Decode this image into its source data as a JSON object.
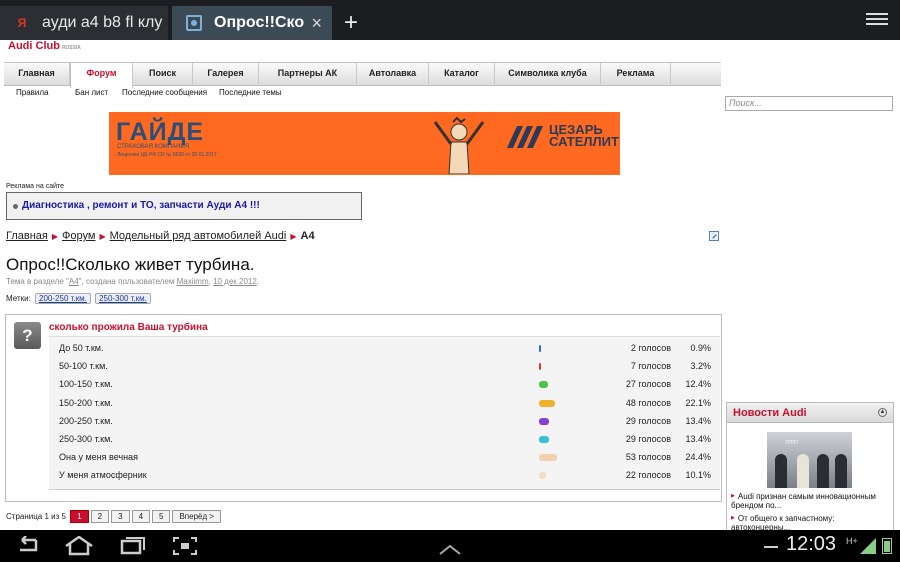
{
  "browser": {
    "tabs": [
      {
        "title": "ауди а4 b8 fl клу",
        "favicon": "yandex-icon",
        "active": false
      },
      {
        "title": "Опрос!!Ско",
        "favicon": "globe-icon",
        "active": true
      }
    ],
    "new_tab": "+",
    "close_glyph": "×"
  },
  "site": {
    "logo": "Audi Club",
    "logo_sub": "RUSSIA",
    "nav": [
      "Главная",
      "Форум",
      "Поиск",
      "Галерея",
      "Партнеры АК",
      "Автолавка",
      "Каталог",
      "Символика клуба",
      "Реклама"
    ],
    "nav_active": "Форум",
    "subnav": [
      "Правила",
      "Бан лист",
      "Последние сообщения",
      "Последние темы"
    ],
    "search_placeholder": "Поиск..."
  },
  "banner": {
    "brand": "ГАЙДЕ",
    "brand_sub": "СТРАХОВАЯ КОМПАНИЯ",
    "brand_license": "Лицензия ЦБ РФ СИ № 0630 от 29.01.2017",
    "partner_line1": "ЦЕЗАРЬ",
    "partner_line2": "САТЕЛЛИТ",
    "color": "#ff6a20"
  },
  "ad": {
    "label": "Реклама на сайте",
    "link": "Диагностика , ремонт и ТО, запчасти Ауди А4 !!!"
  },
  "breadcrumb": [
    "Главная",
    "Форум",
    "Модельный ряд автомобилей Audi",
    "A4"
  ],
  "thread": {
    "title": "Опрос!!Сколько живет турбина.",
    "meta_prefix": "Тема в разделе \"",
    "meta_section": "A4",
    "meta_middle": "\", создана пользователем ",
    "meta_user": "Maxiimm",
    "meta_sep": ", ",
    "meta_date": "10 дек 2012",
    "meta_end": ".",
    "tags_label": "Метки:",
    "tags": [
      "200-250 т.км.",
      "250-300 т.км."
    ]
  },
  "poll": {
    "icon": "?",
    "title": "сколько прожила Ваша турбина",
    "options": [
      {
        "label": "До 50 т.км.",
        "votes": "2 голосов",
        "pct": "0.9%",
        "share": 0.9,
        "color": "#2a6fd6"
      },
      {
        "label": "50-100 т.км.",
        "votes": "7 голосов",
        "pct": "3.2%",
        "share": 3.2,
        "color": "#e03a2a"
      },
      {
        "label": "100-150 т.км.",
        "votes": "27 голосов",
        "pct": "12.4%",
        "share": 12.4,
        "color": "#4cc24c"
      },
      {
        "label": "150-200 т.км.",
        "votes": "48 голосов",
        "pct": "22.1%",
        "share": 22.1,
        "color": "#f0b030"
      },
      {
        "label": "200-250 т.км.",
        "votes": "29 голосов",
        "pct": "13.4%",
        "share": 13.4,
        "color": "#8a3fd0"
      },
      {
        "label": "250-300 т.км.",
        "votes": "29 голосов",
        "pct": "13.4%",
        "share": 13.4,
        "color": "#38c0d8"
      },
      {
        "label": "Она у меня вечная",
        "votes": "53 голосов",
        "pct": "24.4%",
        "share": 24.4,
        "color": "#f3d0b0"
      },
      {
        "label": "У меня атмосферник",
        "votes": "22 голосов",
        "pct": "10.1%",
        "share": 10.1,
        "color": "#f7dcc4"
      }
    ]
  },
  "pager": {
    "label": "Страница 1 из 5",
    "pages": [
      "1",
      "2",
      "3",
      "4",
      "5"
    ],
    "current": "1",
    "next": "Вперёд >"
  },
  "news": {
    "title": "Новости Audi",
    "collapse": "▲",
    "items": [
      "Audi признан самым инновационным брендом по...",
      "От общего к запчастному: автоконцерны..."
    ]
  },
  "system": {
    "clock": "12:03",
    "signal": "H+"
  }
}
